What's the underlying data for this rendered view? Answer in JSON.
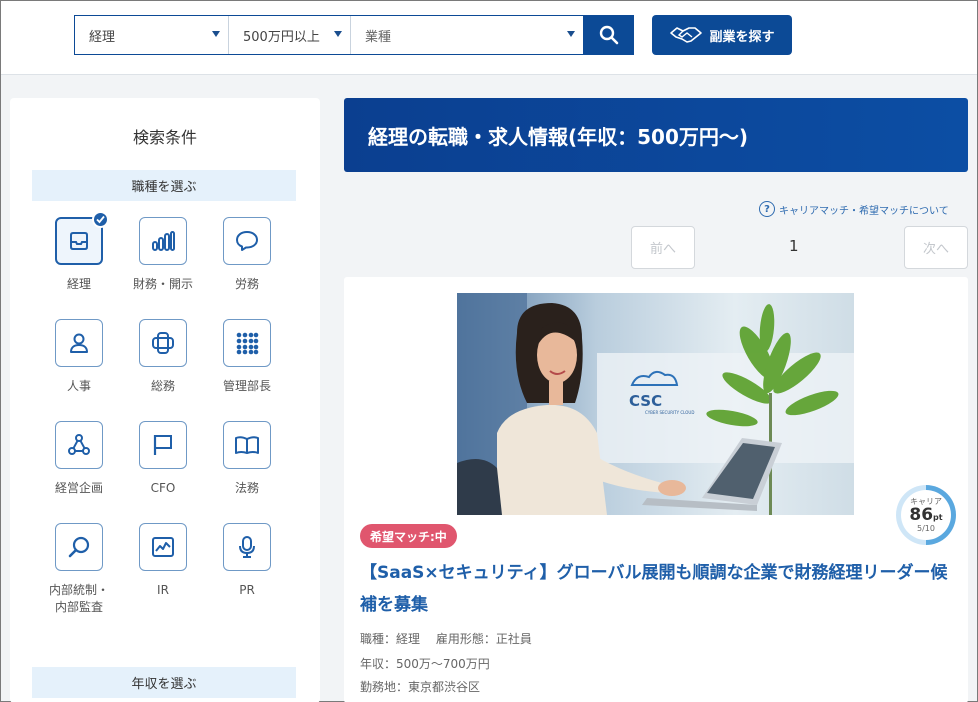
{
  "search": {
    "job_type": "経理",
    "salary": "500万円以上",
    "industry_placeholder": "業種",
    "side_job_button": "副業を探す"
  },
  "sidebar": {
    "title": "検索条件",
    "job_section": "職種を選ぶ",
    "categories": [
      {
        "label": "経理",
        "icon": "inbox-icon",
        "selected": true
      },
      {
        "label": "財務・開示",
        "icon": "bar-chart-icon",
        "selected": false
      },
      {
        "label": "労務",
        "icon": "speech-bubble-icon",
        "selected": false
      },
      {
        "label": "人事",
        "icon": "person-icon",
        "selected": false
      },
      {
        "label": "総務",
        "icon": "cross-box-icon",
        "selected": false
      },
      {
        "label": "管理部長",
        "icon": "grid-icon",
        "selected": false
      },
      {
        "label": "経営企画",
        "icon": "network-icon",
        "selected": false
      },
      {
        "label": "CFO",
        "icon": "flag-icon",
        "selected": false
      },
      {
        "label": "法務",
        "icon": "book-icon",
        "selected": false
      },
      {
        "label": "内部統制・",
        "label2": "内部監査",
        "icon": "magnifier-icon",
        "selected": false
      },
      {
        "label": "IR",
        "icon": "line-chart-icon",
        "selected": false
      },
      {
        "label": "PR",
        "icon": "microphone-icon",
        "selected": false
      }
    ],
    "salary_section": "年収を選ぶ"
  },
  "main": {
    "heading": "経理の転職・求人情報(年収：500万円〜)",
    "help_link": "キャリアマッチ・希望マッチについて",
    "prev": "前へ",
    "next": "次へ",
    "page": "1"
  },
  "job": {
    "photo_logo": "CSC",
    "photo_logo_sub": "CYBER SECURITY CLOUD",
    "score_label": "キャリア",
    "score_value": "86",
    "score_unit": "pt",
    "score_rank": "5/10",
    "score_fraction": 0.5,
    "match_badge": "希望マッチ:中",
    "title": "【SaaS×セキュリティ】グローバル展開も順調な企業で財務経理リーダー候補を募集",
    "type_line": "職種：経理　 雇用形態：正社員",
    "salary_line": "年収：500万〜700万円",
    "location_line": "勤務地：東京都渋谷区"
  },
  "colors": {
    "primary": "#0c4a96",
    "link": "#1f5fa9",
    "badge": "#e0566e",
    "section_bg": "#e5f1fb"
  }
}
